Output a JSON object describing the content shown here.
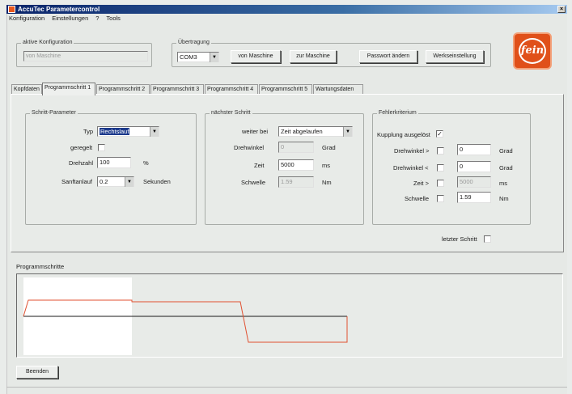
{
  "window": {
    "title": "AccuTec Parametercontrol",
    "close_glyph": "×"
  },
  "menu": [
    "Konfiguration",
    "Einstellungen",
    "?",
    "Tools"
  ],
  "config": {
    "legend": "aktive Konfiguration",
    "value": "von Maschine"
  },
  "transfer": {
    "legend": "Übertragung",
    "port": "COM3",
    "btn_from": "von Maschine",
    "btn_to": "zur Maschine",
    "btn_password": "Passwort ändern",
    "btn_factory": "Werkseinstellung"
  },
  "logo": {
    "text": "fein",
    "color": "#e0501a"
  },
  "tabs": [
    "Kopfdaten",
    "Programmschritt 1",
    "Programmschritt 2",
    "Programmschritt 3",
    "Programmschritt 4",
    "Programmschritt 5",
    "Wartungsdaten"
  ],
  "step_params": {
    "legend": "Schritt-Parameter",
    "typ_label": "Typ",
    "typ_value": "Rechtslauf",
    "geregelt_label": "geregelt",
    "drehzahl_label": "Drehzahl",
    "drehzahl_value": "100",
    "drehzahl_unit": "%",
    "sanftanlauf_label": "Sanftanlauf",
    "sanftanlauf_value": "0.2",
    "sanftanlauf_unit": "Sekunden"
  },
  "next_step": {
    "legend": "nächster Schritt",
    "weiter_label": "weiter bei",
    "weiter_value": "Zeit abgelaufen",
    "drehwinkel_label": "Drehwinkel",
    "drehwinkel_value": "0",
    "drehwinkel_unit": "Grad",
    "zeit_label": "Zeit",
    "zeit_value": "5000",
    "zeit_unit": "ms",
    "schwelle_label": "Schwelle",
    "schwelle_value": "1.59",
    "schwelle_unit": "Nm"
  },
  "error_crit": {
    "legend": "Fehlerkriterium",
    "kupplung_label": "Kupplung ausgelöst",
    "kupplung_checked": "✓",
    "dw_gt_label": "Drehwinkel >",
    "dw_gt_value": "0",
    "dw_gt_unit": "Grad",
    "dw_lt_label": "Drehwinkel <",
    "dw_lt_value": "0",
    "dw_lt_unit": "Grad",
    "zeit_label": "Zeit >",
    "zeit_value": "5000",
    "zeit_unit": "ms",
    "schwelle_label": "Schwelle",
    "schwelle_value": "1.59",
    "schwelle_unit": "Nm"
  },
  "last_step_label": "letzter Schritt",
  "program_steps": {
    "label": "Programmschritte"
  },
  "btn_exit": "Beenden",
  "colors": {
    "speed_line": "#1a1a1a",
    "torque_line": "#e05030",
    "highlight": "#ffffff"
  }
}
